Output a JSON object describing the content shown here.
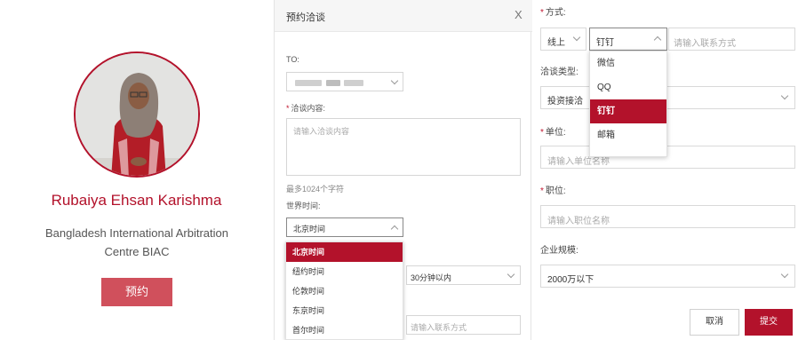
{
  "profile": {
    "name": "Rubaiya Ehsan Karishma",
    "org_line1": "Bangladesh International Arbitration",
    "org_line2": "Centre BIAC",
    "book_button": "预约"
  },
  "modal": {
    "title": "预约洽谈",
    "close": "X",
    "to_label": "TO:",
    "content_label": "洽谈内容:",
    "content_placeholder": "请输入洽谈内容",
    "char_limit": "最多1024个字符",
    "world_time_label": "世界时间:",
    "world_time_selected": "北京时间",
    "timezone_options": [
      "北京时间",
      "纽约时间",
      "伦敦时间",
      "东京时间",
      "首尔时间"
    ],
    "timezone_selected_index": 0,
    "duration_selected": "30分钟以内",
    "contact_placeholder": "请输入联系方式"
  },
  "form": {
    "method_label": "方式:",
    "online_value": "线上",
    "contact_type_selected": "钉钉",
    "contact_placeholder": "请输入联系方式",
    "contact_options": [
      "微信",
      "QQ",
      "钉钉",
      "邮箱"
    ],
    "contact_selected_index": 2,
    "type_label": "洽谈类型:",
    "type_value": "投资接洽",
    "unit_label": "单位:",
    "unit_placeholder": "请输入单位名称",
    "position_label": "职位:",
    "position_placeholder": "请输入职位名称",
    "scale_label": "企业规模:",
    "scale_value": "2000万以下",
    "cancel_button": "取消",
    "submit_button": "提交"
  },
  "colors": {
    "accent": "#b3122b",
    "book_button": "#d0505c"
  }
}
